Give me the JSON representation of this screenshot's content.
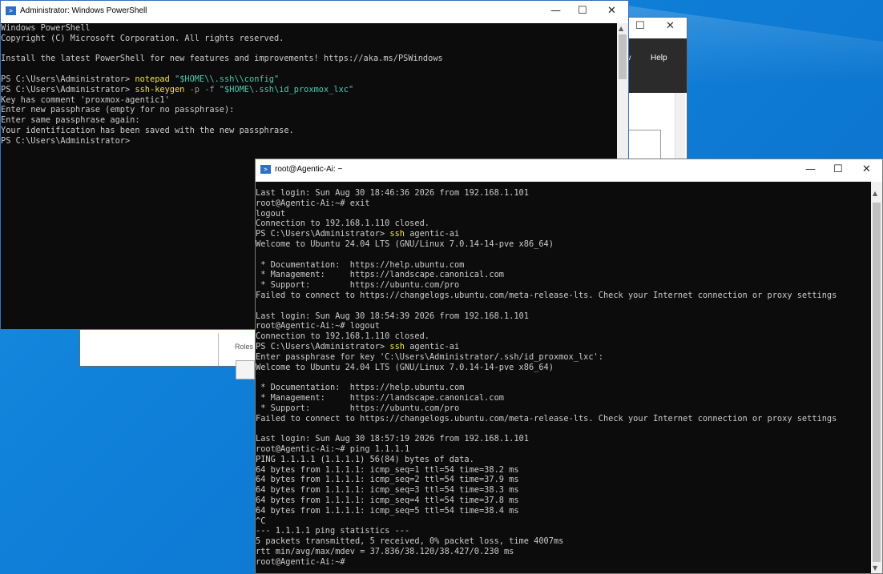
{
  "background_window": {
    "menu_items": [
      "w",
      "Help"
    ],
    "side_label": "Roles",
    "controls": {
      "maximize": "☐",
      "close": "✕"
    }
  },
  "powershell_window": {
    "title": "Administrator: Windows PowerShell",
    "controls": {
      "minimize": "—",
      "maximize": "☐",
      "close": "✕"
    },
    "lines": [
      "Windows PowerShell",
      "Copyright (C) Microsoft Corporation. All rights reserved.",
      "",
      "Install the latest PowerShell for new features and improvements! https://aka.ms/PSWindows",
      "",
      "PS C:\\Users\\Administrator> ",
      "PS C:\\Users\\Administrator> ",
      "Key has comment 'proxmox-agentic1'",
      "Enter new passphrase (empty for no passphrase):",
      "Enter same passphrase again:",
      "Your identification has been saved with the new passphrase.",
      "PS C:\\Users\\Administrator>"
    ],
    "cmd1": {
      "cmd": "notepad",
      "arg": "\"$HOME\\\\.ssh\\\\config\""
    },
    "cmd2": {
      "cmd": "ssh-keygen",
      "flags": " -p -f ",
      "arg": "\"$HOME\\.ssh\\id_proxmox_lxc\""
    }
  },
  "ssh_window": {
    "title": "root@Agentic-Ai: ~",
    "controls": {
      "minimize": "—",
      "maximize": "☐",
      "close": "✕"
    },
    "lines": [
      "Last login: Sun Aug 30 18:46:36 2026 from 192.168.1.101",
      "root@Agentic-Ai:~# exit",
      "logout",
      "Connection to 192.168.1.110 closed.",
      "PS C:\\Users\\Administrator> ",
      "Welcome to Ubuntu 24.04 LTS (GNU/Linux 7.0.14-14-pve x86_64)",
      "",
      " * Documentation:  https://help.ubuntu.com",
      " * Management:     https://landscape.canonical.com",
      " * Support:        https://ubuntu.com/pro",
      "Failed to connect to https://changelogs.ubuntu.com/meta-release-lts. Check your Internet connection or proxy settings",
      "",
      "Last login: Sun Aug 30 18:54:39 2026 from 192.168.1.101",
      "root@Agentic-Ai:~# logout",
      "Connection to 192.168.1.110 closed.",
      "PS C:\\Users\\Administrator> ",
      "Enter passphrase for key 'C:\\Users\\Administrator/.ssh/id_proxmox_lxc':",
      "Welcome to Ubuntu 24.04 LTS (GNU/Linux 7.0.14-14-pve x86_64)",
      "",
      " * Documentation:  https://help.ubuntu.com",
      " * Management:     https://landscape.canonical.com",
      " * Support:        https://ubuntu.com/pro",
      "Failed to connect to https://changelogs.ubuntu.com/meta-release-lts. Check your Internet connection or proxy settings",
      "",
      "Last login: Sun Aug 30 18:57:19 2026 from 192.168.1.101",
      "root@Agentic-Ai:~# ping 1.1.1.1",
      "PING 1.1.1.1 (1.1.1.1) 56(84) bytes of data.",
      "64 bytes from 1.1.1.1: icmp_seq=1 ttl=54 time=38.2 ms",
      "64 bytes from 1.1.1.1: icmp_seq=2 ttl=54 time=37.9 ms",
      "64 bytes from 1.1.1.1: icmp_seq=3 ttl=54 time=38.3 ms",
      "64 bytes from 1.1.1.1: icmp_seq=4 ttl=54 time=37.8 ms",
      "64 bytes from 1.1.1.1: icmp_seq=5 ttl=54 time=38.4 ms",
      "^C",
      "--- 1.1.1.1 ping statistics ---",
      "5 packets transmitted, 5 received, 0% packet loss, time 4007ms",
      "rtt min/avg/max/mdev = 37.836/38.120/38.427/0.230 ms",
      "root@Agentic-Ai:~#"
    ],
    "ssh_cmd": "ssh",
    "ssh_arg": " agentic-ai"
  }
}
